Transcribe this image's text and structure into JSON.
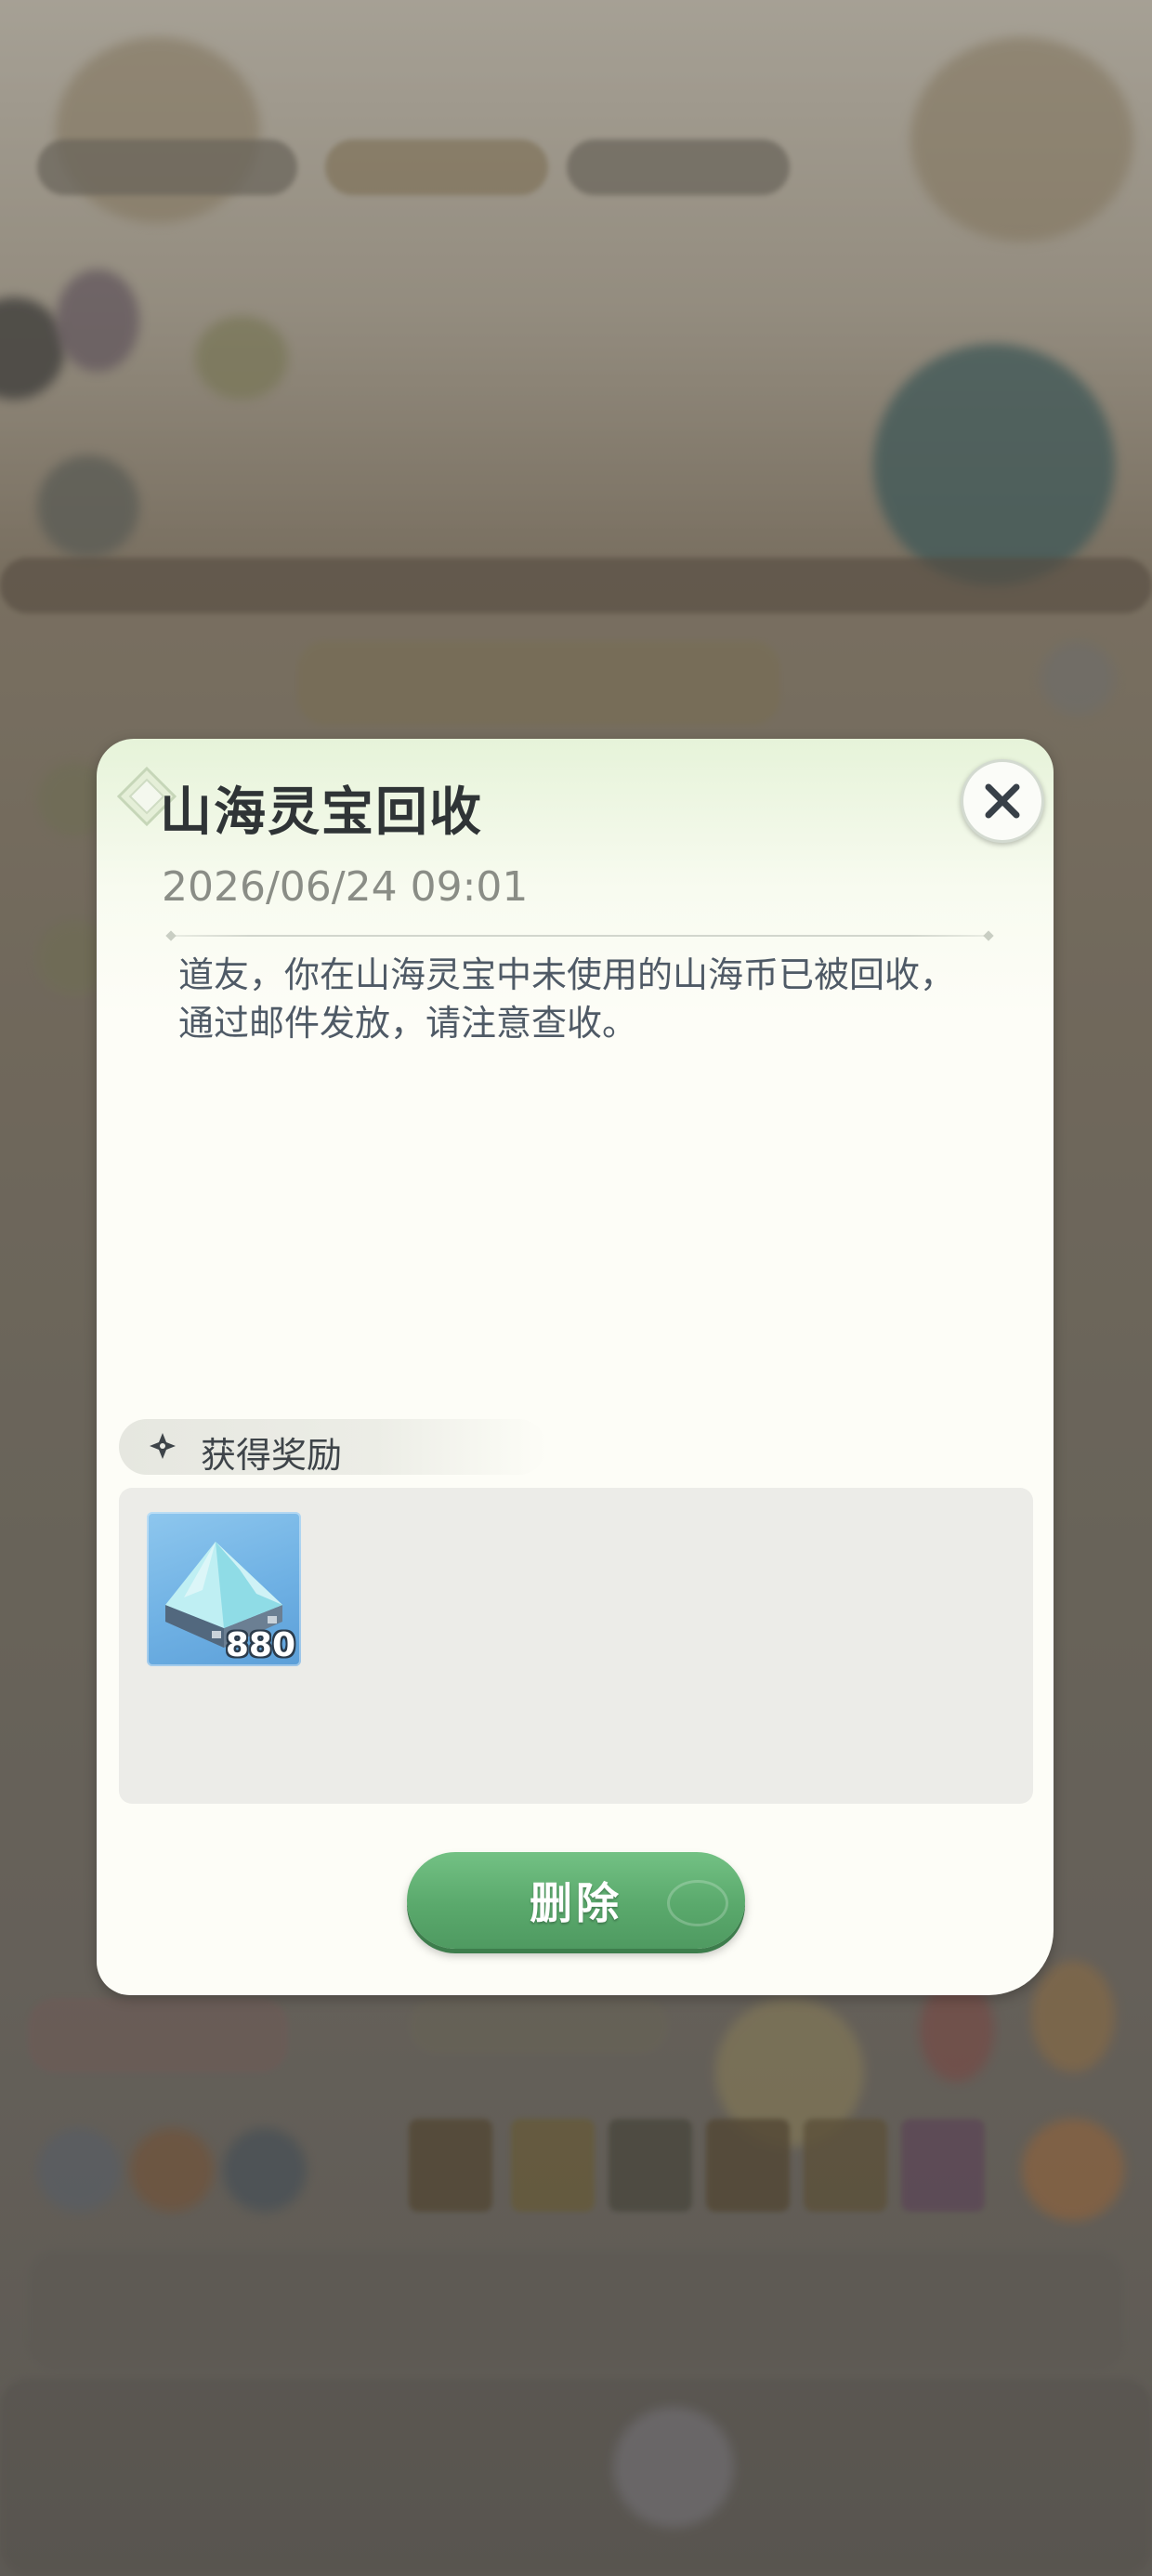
{
  "dialog": {
    "title": "山海灵宝回收",
    "date": "2026/06/24 09:01",
    "body_line1": "道友，你在山海灵宝中未使用的山海币已被回收，",
    "body_line2": "通过邮件发放，请注意查收。",
    "close_icon": "close-icon"
  },
  "rewards": {
    "header": "获得奖励",
    "items": [
      {
        "icon": "ice-crystal-icon",
        "count": "880"
      }
    ]
  },
  "actions": {
    "delete_label": "删除"
  },
  "colors": {
    "accent_green": "#5aa96c",
    "title_text": "#2f3436",
    "body_text": "#4f5a66",
    "date_text": "#8a8d86"
  }
}
